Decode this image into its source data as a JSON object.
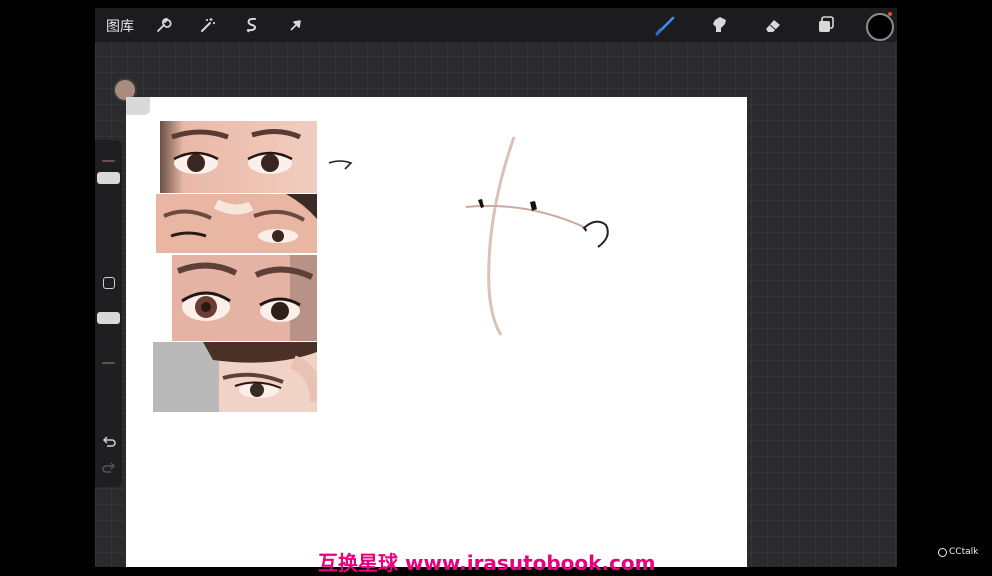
{
  "toolbar": {
    "gallery_label": "图库",
    "left_tools": [
      "wrench-icon",
      "magic-wand-icon",
      "selection-icon",
      "transform-arrow-icon"
    ],
    "right_tools": [
      "brush-icon",
      "smudge-icon",
      "eraser-icon",
      "layers-icon"
    ],
    "active_tool": "brush-icon",
    "active_color": "#000000",
    "brush_accent": "#3a8ff0"
  },
  "sidebar": {
    "undo_icon": "undo-arrow-icon",
    "redo_icon": "redo-arrow-icon"
  },
  "swatch_color": "#a98a7f",
  "canvas": {
    "reference_images": [
      "eye-photo-1",
      "eye-photo-2",
      "eye-photo-3",
      "eye-photo-4"
    ]
  },
  "watermark": {
    "text": "互换星球 www.irasutobook.com"
  },
  "cctalk": {
    "text": "CCtalk"
  }
}
